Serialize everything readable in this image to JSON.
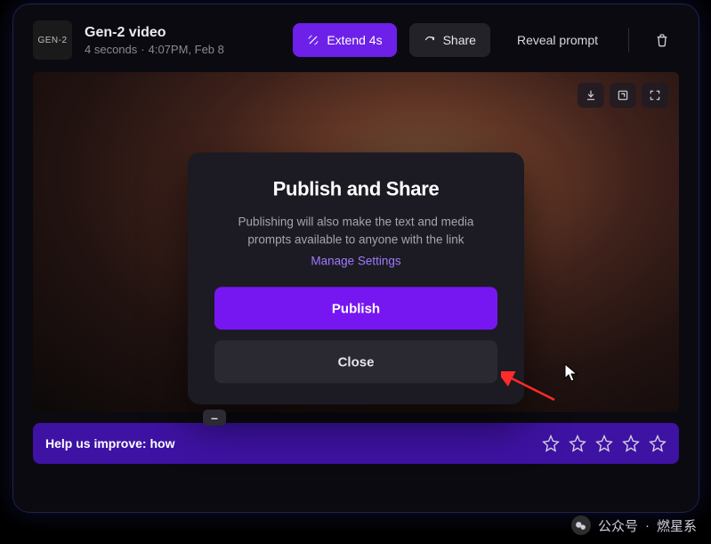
{
  "header": {
    "model_badge": "GEN-2",
    "title": "Gen-2 video",
    "duration": "4 seconds",
    "timestamp": "4:07PM, Feb 8",
    "extend_label": "Extend 4s",
    "share_label": "Share",
    "reveal_label": "Reveal prompt"
  },
  "video_tools": {
    "t1": "download-icon",
    "t2": "upscale-icon",
    "t3": "fullscreen-icon"
  },
  "feedback": {
    "prompt": "Help us improve: how"
  },
  "modal": {
    "title": "Publish and Share",
    "desc_line1": "Publishing will also make the text and media",
    "desc_line2": "prompts available to anyone with the link",
    "link": "Manage Settings",
    "publish": "Publish",
    "close": "Close"
  },
  "watermark": {
    "label": "公众号",
    "sep": "·",
    "name": "燃星系"
  }
}
